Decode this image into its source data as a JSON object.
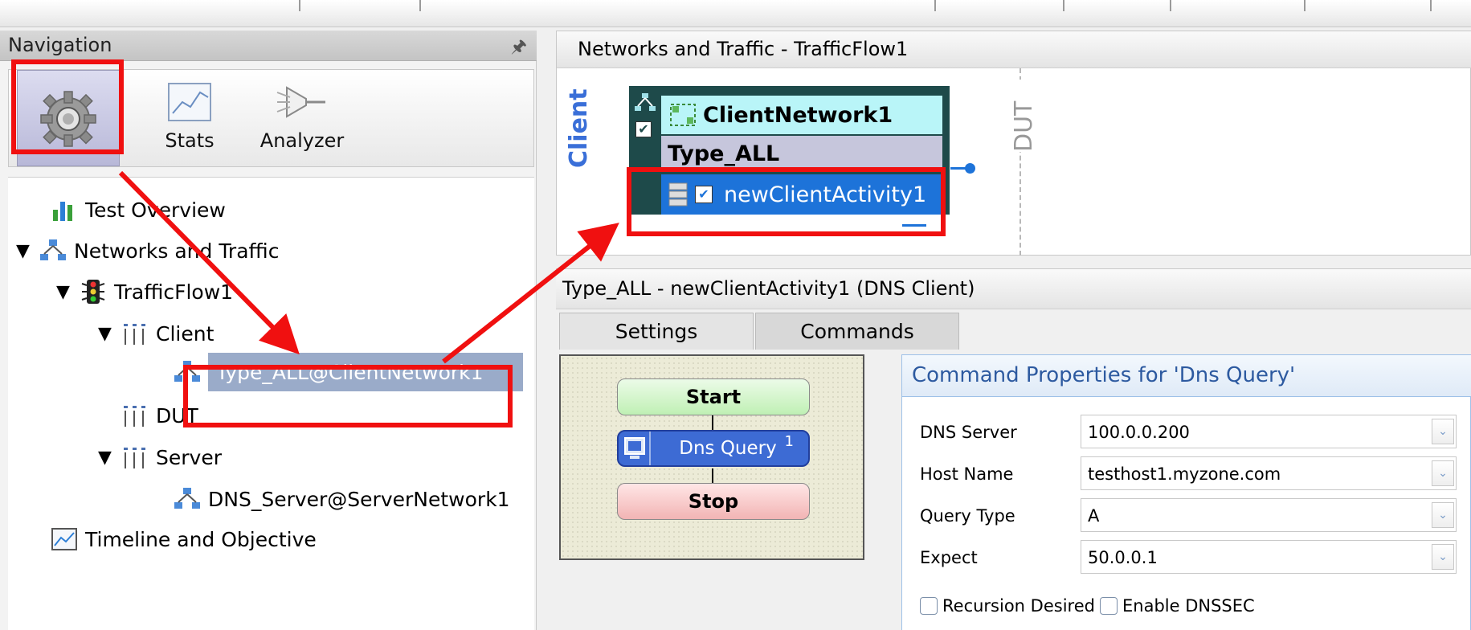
{
  "navigation": {
    "title": "Navigation",
    "tools": [
      {
        "label": ""
      },
      {
        "label": "Stats"
      },
      {
        "label": "Analyzer"
      }
    ],
    "tree": {
      "test_overview": "Test Overview",
      "networks_traffic": "Networks and Traffic",
      "trafficflow": "TrafficFlow1",
      "client": "Client",
      "client_node": "Type_ALL@ClientNetwork1",
      "dut": "DUT",
      "server": "Server",
      "server_node": "DNS_Server@ServerNetwork1",
      "timeline": "Timeline and Objective"
    }
  },
  "networks_panel": {
    "title": "Networks and Traffic - TrafficFlow1",
    "client_label": "Client",
    "dut_label": "DUT",
    "network_name": "ClientNetwork1",
    "type_name": "Type_ALL",
    "activity_name": "newClientActivity1"
  },
  "activity_panel": {
    "title": "Type_ALL - newClientActivity1 (DNS Client)",
    "tabs": [
      "Settings",
      "Commands"
    ],
    "flow": {
      "start": "Start",
      "command": "Dns Query",
      "command_index": "1",
      "stop": "Stop"
    },
    "properties": {
      "title": "Command Properties for 'Dns Query'",
      "fields": [
        {
          "label": "DNS Server",
          "value": "100.0.0.200"
        },
        {
          "label": "Host Name",
          "value": "testhost1.myzone.com"
        },
        {
          "label": "Query Type",
          "value": "A"
        },
        {
          "label": "Expect",
          "value": "50.0.0.1"
        }
      ],
      "recursion_label": "Recursion Desired",
      "dnssec_label": "Enable DNSSEC"
    }
  },
  "colors": {
    "annotation": "#f01010",
    "selection": "#1d73d9",
    "accent_text": "#3a6fd8"
  }
}
